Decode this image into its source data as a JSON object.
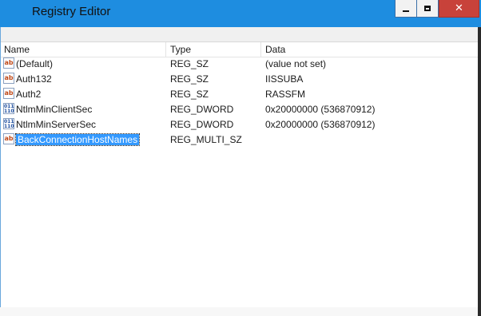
{
  "window": {
    "title": "Registry Editor",
    "controls": {
      "minimize": "",
      "maximize": "",
      "close": "✕"
    }
  },
  "columns": {
    "name": "Name",
    "type": "Type",
    "data": "Data"
  },
  "rows": [
    {
      "icon": "ab",
      "name": "(Default)",
      "type": "REG_SZ",
      "data": "(value not set)",
      "selected": false
    },
    {
      "icon": "ab",
      "name": "Auth132",
      "type": "REG_SZ",
      "data": "IISSUBA",
      "selected": false
    },
    {
      "icon": "ab",
      "name": "Auth2",
      "type": "REG_SZ",
      "data": "RASSFM",
      "selected": false
    },
    {
      "icon": "011",
      "name": "NtlmMinClientSec",
      "type": "REG_DWORD",
      "data": "0x20000000 (536870912)",
      "selected": false
    },
    {
      "icon": "011",
      "name": "NtlmMinServerSec",
      "type": "REG_DWORD",
      "data": "0x20000000 (536870912)",
      "selected": false
    },
    {
      "icon": "ab",
      "name": "BackConnectionHostNames",
      "type": "REG_MULTI_SZ",
      "data": "",
      "selected": true
    }
  ],
  "colors": {
    "titlebar": "#1e8de0",
    "close_button": "#c8423a",
    "selection": "#3399ff"
  }
}
